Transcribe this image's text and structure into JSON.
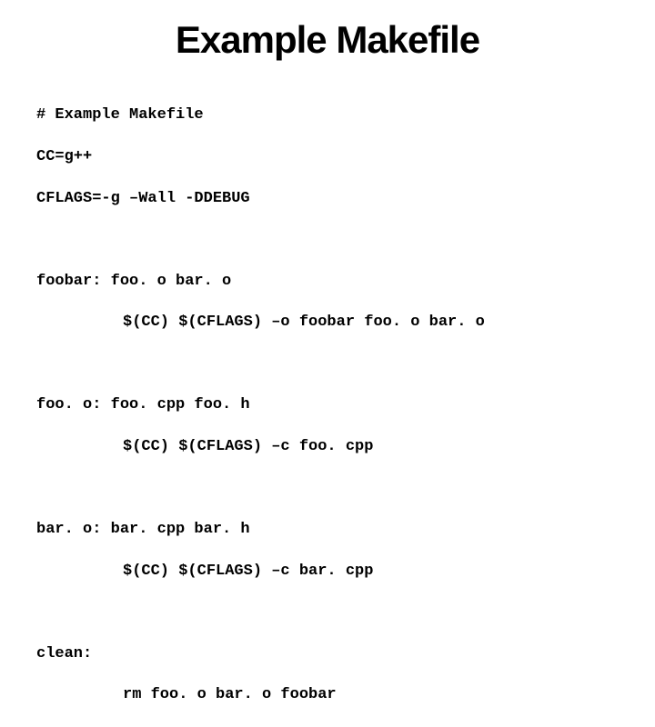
{
  "title": "Example Makefile",
  "code": {
    "l1": "# Example Makefile",
    "l2": "CC=g++",
    "l3": "CFLAGS=-g –Wall -DDEBUG",
    "l4": "foobar: foo. o bar. o",
    "l5": "$(CC) $(CFLAGS) –o foobar foo. o bar. o",
    "l6": "foo. o: foo. cpp foo. h",
    "l7": "$(CC) $(CFLAGS) –c foo. cpp",
    "l8": "bar. o: bar. cpp bar. h",
    "l9": "$(CC) $(CFLAGS) –c bar. cpp",
    "l10": "clean:",
    "l11": "rm foo. o bar. o foobar"
  }
}
